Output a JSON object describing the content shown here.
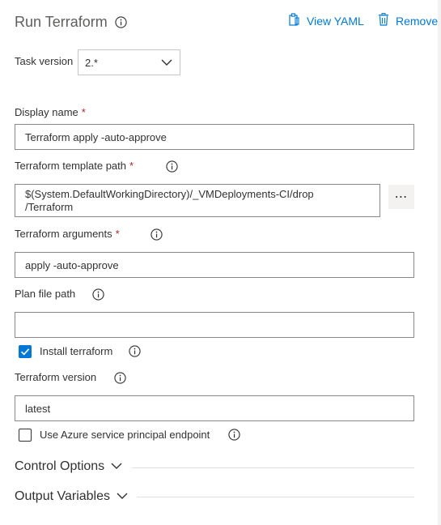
{
  "header": {
    "title": "Run Terraform",
    "view_yaml": "View YAML",
    "remove": "Remove"
  },
  "task_version": {
    "label": "Task version",
    "value": "2.*"
  },
  "display_name": {
    "label": "Display name",
    "required": "*",
    "value": "Terraform apply -auto-approve"
  },
  "template_path": {
    "label": "Terraform template path",
    "required": "*",
    "value_line1": "$(System.DefaultWorkingDirectory)/_VMDeployments-CI/drop",
    "value_line2": "/Terraform",
    "browse": "⋯"
  },
  "arguments": {
    "label": "Terraform arguments",
    "required": "*",
    "value": "apply -auto-approve"
  },
  "plan_file": {
    "label": "Plan file path",
    "value": ""
  },
  "install": {
    "label": "Install terraform",
    "checked": true
  },
  "version": {
    "label": "Terraform version",
    "value": "latest"
  },
  "azure_sp": {
    "label": "Use Azure service principal endpoint",
    "checked": false
  },
  "sections": {
    "control_options": "Control Options",
    "output_variables": "Output Variables"
  },
  "colors": {
    "accent": "#0078d4",
    "required": "#a4262c"
  },
  "icons": [
    "info-icon",
    "clipboard-icon",
    "trash-icon",
    "chevron-down-icon",
    "checkmark-icon",
    "ellipsis-icon"
  ]
}
